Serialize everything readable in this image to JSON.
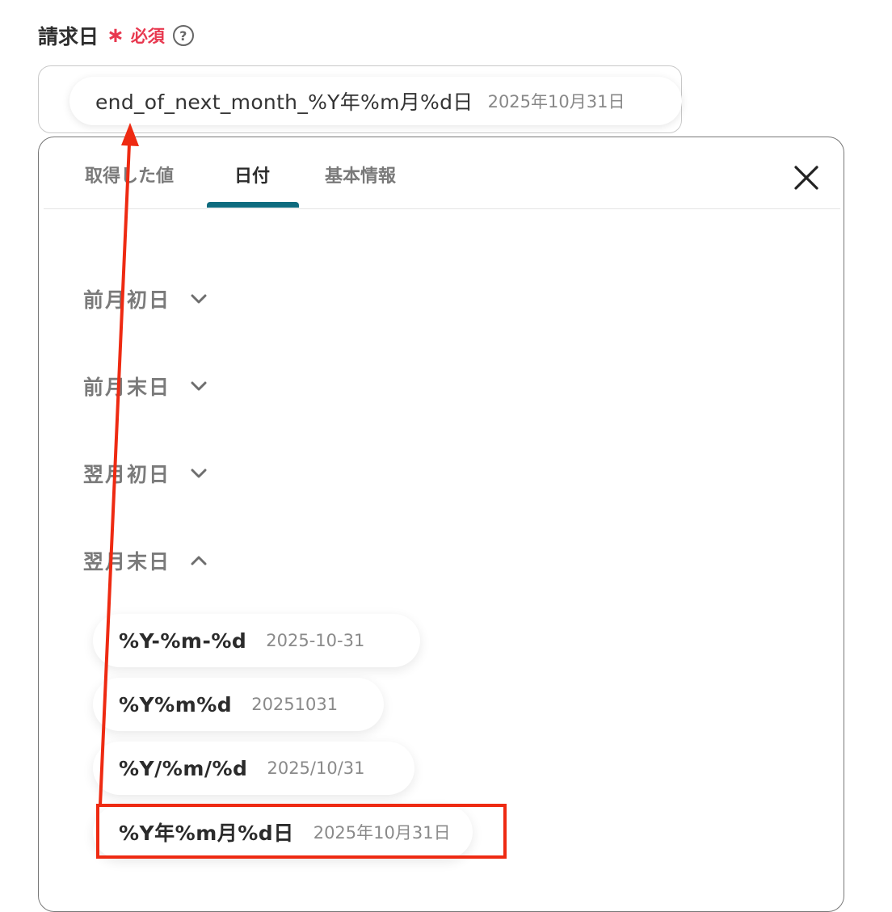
{
  "field": {
    "label": "請求日",
    "required_star": "∗",
    "required_text": "必須",
    "help_glyph": "?"
  },
  "input": {
    "token_name": "end_of_next_month_%Y年%m月%d日",
    "token_value": "2025年10月31日"
  },
  "tabs": [
    {
      "label": "取得した値",
      "active": false
    },
    {
      "label": "日付",
      "active": true
    },
    {
      "label": "基本情報",
      "active": false
    }
  ],
  "sections": [
    {
      "label": "前月初日",
      "expanded": false
    },
    {
      "label": "前月末日",
      "expanded": false
    },
    {
      "label": "翌月初日",
      "expanded": false
    },
    {
      "label": "翌月末日",
      "expanded": true
    }
  ],
  "options": [
    {
      "format": "%Y-%m-%d",
      "sample": "2025-10-31"
    },
    {
      "format": "%Y%m%d",
      "sample": "20251031"
    },
    {
      "format": "%Y/%m/%d",
      "sample": "2025/10/31"
    },
    {
      "format": "%Y年%m月%d日",
      "sample": "2025年10月31日"
    }
  ],
  "icons": {
    "close": "close-icon",
    "chevron_down": "chevron-down-icon",
    "chevron_up": "chevron-up-icon",
    "help": "help-icon"
  },
  "colors": {
    "required": "#e8384f",
    "tab_active_underline": "#0e6b7e",
    "annotation": "#ee2a12"
  }
}
